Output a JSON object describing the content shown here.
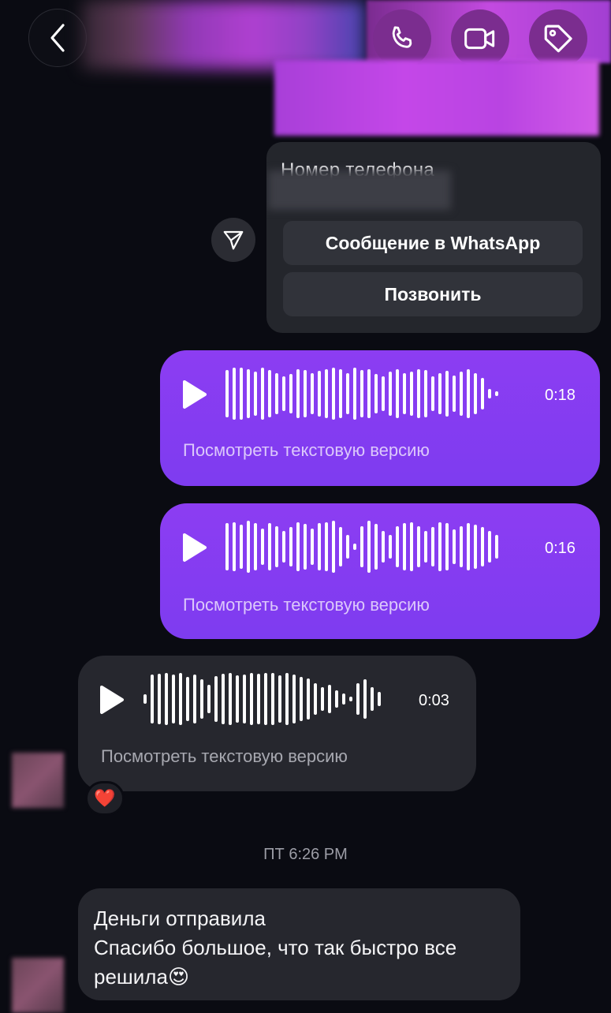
{
  "header": {
    "back_icon": "chevron-left-icon",
    "buttons": [
      {
        "name": "call-button",
        "icon": "phone-icon"
      },
      {
        "name": "video-call-button",
        "icon": "video-camera-icon"
      },
      {
        "name": "label-button",
        "icon": "tag-icon"
      }
    ]
  },
  "contact_card": {
    "title": "Номер телефона",
    "whatsapp_label": "Сообщение в WhatsApp",
    "call_label": "Позвонить"
  },
  "messages": {
    "voice_1": {
      "duration": "0:18",
      "link": "Посмотреть текстовую версию"
    },
    "voice_2": {
      "duration": "0:16",
      "link": "Посмотреть текстовую версию"
    },
    "voice_3": {
      "duration": "0:03",
      "link": "Посмотреть текстовую версию",
      "reaction": "❤️"
    },
    "timestamp": "ПТ 6:26 PM",
    "text_message": {
      "line_1": "Деньги отправила",
      "line_2": "Спасибо большое, что так быстро все",
      "line_3": "решила",
      "emoji": "😍"
    }
  },
  "colors": {
    "background": "#0a0b12",
    "outgoing_bubble": "#8c3df2",
    "incoming_bubble": "#26272e",
    "header_buttons": "#7b2d8f"
  }
}
